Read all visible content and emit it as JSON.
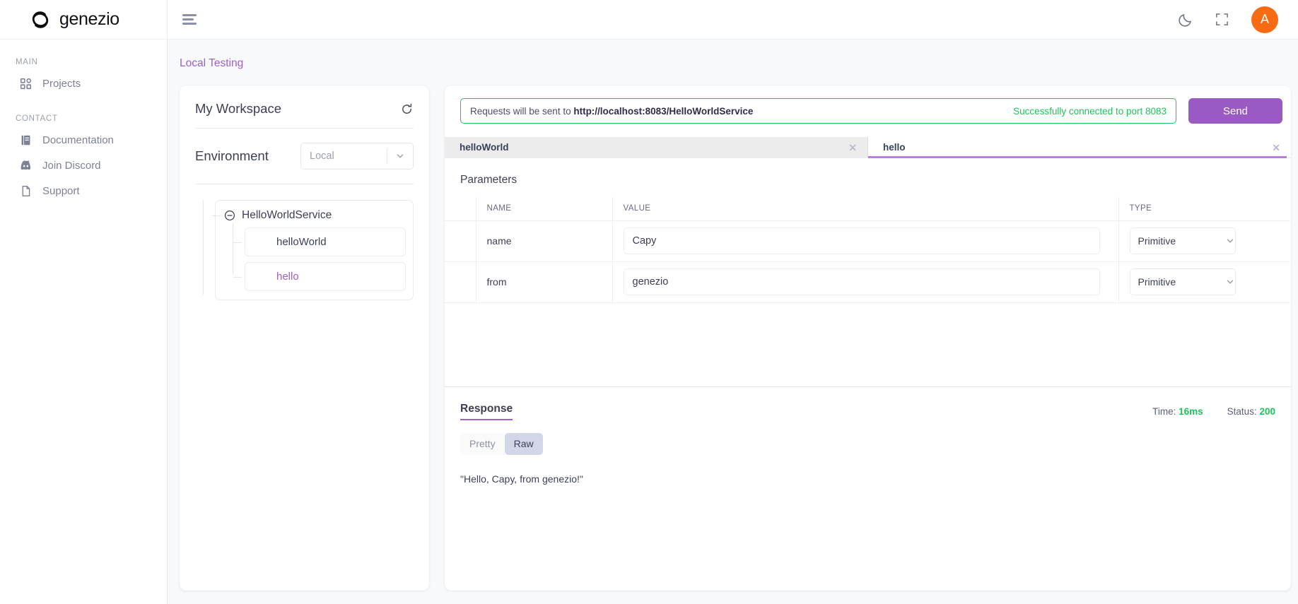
{
  "brand": {
    "name": "genezio",
    "logo_icon": "genezio-logo-icon"
  },
  "sidebar": {
    "sections": [
      {
        "title": "MAIN",
        "items": [
          {
            "label": "Projects",
            "icon": "grid-icon"
          }
        ]
      },
      {
        "title": "CONTACT",
        "items": [
          {
            "label": "Documentation",
            "icon": "book-icon"
          },
          {
            "label": "Join Discord",
            "icon": "discord-icon"
          },
          {
            "label": "Support",
            "icon": "file-icon"
          }
        ]
      }
    ]
  },
  "topbar": {
    "menu_icon": "hamburger-icon",
    "dark_mode_icon": "moon-icon",
    "fullscreen_icon": "fullscreen-icon",
    "avatar_initial": "A"
  },
  "breadcrumb": "Local Testing",
  "workspace": {
    "title": "My Workspace",
    "refresh_icon": "refresh-icon",
    "environment_label": "Environment",
    "environment_value": "Local",
    "environment_options": [
      "Local"
    ],
    "tree": {
      "service": "HelloWorldService",
      "collapse_icon": "minus-circle-icon",
      "methods": [
        {
          "label": "helloWorld",
          "active": false
        },
        {
          "label": "hello",
          "active": true
        }
      ]
    }
  },
  "request": {
    "url_prefix": "Requests will be sent to ",
    "url": "http://localhost:8083/HelloWorldService",
    "connection_status": "Successfully connected to port 8083",
    "send_label": "Send",
    "tabs": [
      {
        "label": "helloWorld",
        "active": false,
        "close_icon": "close-icon"
      },
      {
        "label": "hello",
        "active": true,
        "close_icon": "close-icon"
      }
    ],
    "parameters_title": "Parameters",
    "table": {
      "headers": [
        "",
        "NAME",
        "VALUE",
        "TYPE"
      ],
      "rows": [
        {
          "name": "name",
          "value": "Capy",
          "type": "Primitive"
        },
        {
          "name": "from",
          "value": "genezio",
          "type": "Primitive"
        }
      ],
      "type_options": [
        "Primitive"
      ]
    }
  },
  "response": {
    "title": "Response",
    "time_label": "Time:",
    "time_value": "16ms",
    "status_label": "Status:",
    "status_value": "200",
    "view_modes": [
      {
        "label": "Pretty",
        "active": false
      },
      {
        "label": "Raw",
        "active": true
      }
    ],
    "body": "\"Hello, Capy, from genezio!\""
  },
  "colors": {
    "accent_purple": "#9b59c3",
    "breadcrumb_purple": "#a05fc9",
    "success_green": "#1dc45a",
    "avatar_orange": "#f96b12",
    "content_bg": "#f7f9fb"
  }
}
